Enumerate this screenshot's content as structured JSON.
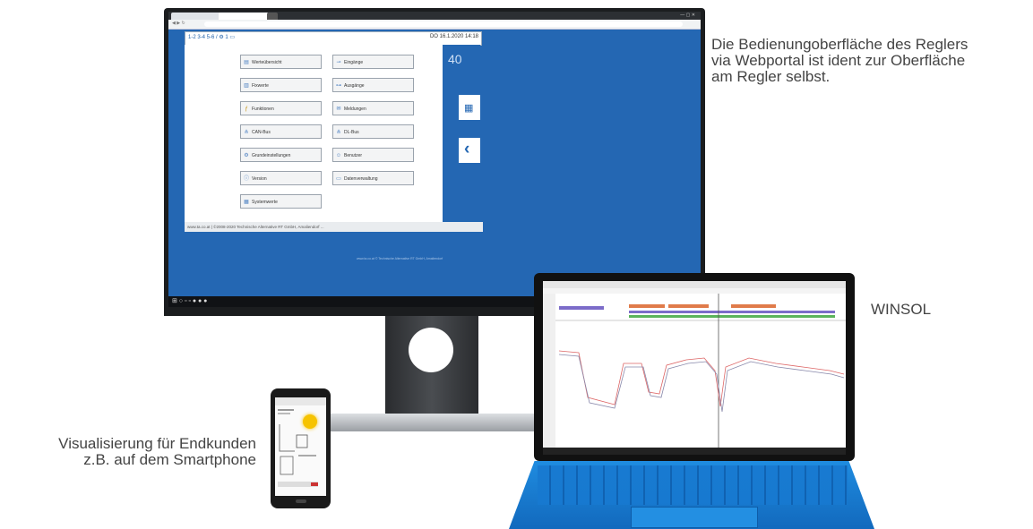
{
  "captions": {
    "webportal": [
      "Die Bedienungoberfläche des Reglers",
      "via Webportal ist ident zur Oberfläche",
      "am Regler selbst."
    ],
    "winsol": "WINSOL",
    "smartphone": [
      "Visualisierung für Endkunden",
      "z.B. auf dem Smartphone"
    ]
  },
  "regler": {
    "top_bar_left": "1-2  3-4  5-6  /  ⚙  1  ▭",
    "top_bar_right": "DO 16.1.2020 14:18",
    "side_number": "40",
    "buttons": [
      {
        "label": "Werteübersicht",
        "icon": "overview-icon"
      },
      {
        "label": "Eingänge",
        "icon": "inputs-icon"
      },
      {
        "label": "Fixwerte",
        "icon": "fixed-values-icon"
      },
      {
        "label": "Ausgänge",
        "icon": "outputs-icon"
      },
      {
        "label": "Funktionen",
        "icon": "functions-icon"
      },
      {
        "label": "Meldungen",
        "icon": "messages-icon"
      },
      {
        "label": "CAN-Bus",
        "icon": "can-bus-icon"
      },
      {
        "label": "DL-Bus",
        "icon": "dl-bus-icon"
      },
      {
        "label": "Grundeinstellungen",
        "icon": "settings-icon"
      },
      {
        "label": "Benutzer",
        "icon": "user-icon"
      },
      {
        "label": "Version",
        "icon": "version-icon"
      },
      {
        "label": "Datenverwaltung",
        "icon": "folder-icon"
      },
      {
        "label": "Systemwerte",
        "icon": "system-values-icon"
      }
    ],
    "footer": "www.ta.co.at | ©2008-2020 Technische Alternative RT GmbH, Amaliendorf ..."
  },
  "webpage_copyright": "www.ta.co.at  ©  Technische Alternative RT GmbH, Amaliendorf"
}
